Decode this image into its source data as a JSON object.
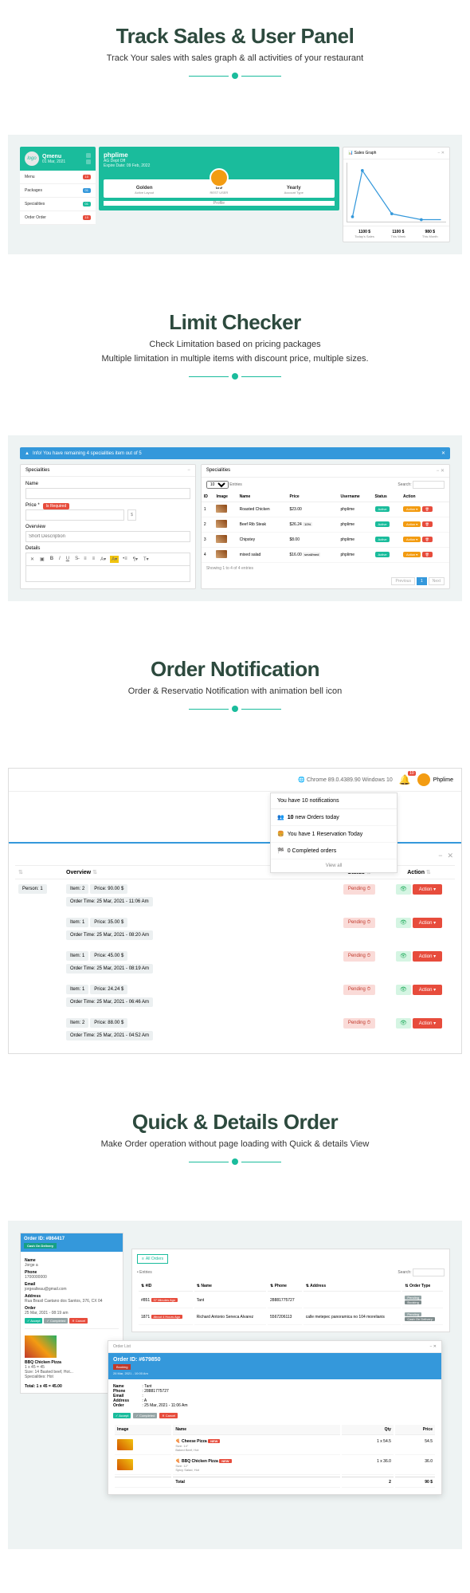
{
  "section1": {
    "title": "Track Sales & User Panel",
    "subtitle": "Track Your sales with sales graph & all activities of your restaurant",
    "sidebar": {
      "name": "Qmenu",
      "date": "01 Mar, 2021",
      "links": [
        {
          "label": "Menu",
          "badge": "10",
          "badgeClass": "bg-red"
        },
        {
          "label": "Packages",
          "badge": "01",
          "badgeClass": "bg-blue"
        },
        {
          "label": "Specialities",
          "badge": "01",
          "badgeClass": "bg-green"
        },
        {
          "label": "Order Order",
          "badge": "10",
          "badgeClass": "bg-red"
        }
      ]
    },
    "center": {
      "name": "phplime",
      "sub": "AG Dept Off",
      "date": "Expire Date: 09 Feb, 2022",
      "stats": [
        {
          "val": "Golden",
          "lbl": "Active Layout"
        },
        {
          "val": "0/9",
          "lbl": "REST USER"
        },
        {
          "val": "Yearly",
          "lbl": "Account Type"
        }
      ],
      "profile": "Profile"
    },
    "graph": {
      "title": "Sales Graph",
      "ymax": "700",
      "footer": [
        {
          "val": "1100 $",
          "lbl": "Today's Sales"
        },
        {
          "val": "1100 $",
          "lbl": "This Week"
        },
        {
          "val": "980 $",
          "lbl": "This Month"
        }
      ]
    }
  },
  "section2": {
    "title": "Limit Checker",
    "subtitle1": "Check Limitation based on pricing packages",
    "subtitle2": "Multiple limitation in multiple items with discount price, multiple sizes.",
    "infobar": "Info! You have remaining 4 specialities item out of 5",
    "form": {
      "title": "Specialities",
      "name": "Name",
      "price": "Price *",
      "required": "Is Required",
      "overview": "Overview",
      "details": "Details"
    },
    "table": {
      "title": "Specialities",
      "entries": "10",
      "entriesLabel": "Entries",
      "search": "Search:",
      "cols": [
        "ID",
        "Image",
        "Name",
        "Price",
        "Username",
        "Status",
        "Action"
      ],
      "rows": [
        {
          "id": "1",
          "name": "Roasted Chicken",
          "price": "$23.00",
          "user": "phplime"
        },
        {
          "id": "2",
          "name": "Beef Rib Steak",
          "price": "$26.24",
          "extra": "10%",
          "user": "phplime"
        },
        {
          "id": "3",
          "name": "Chipstey",
          "price": "$8.00",
          "user": "phplime"
        },
        {
          "id": "4",
          "name": "mixed salad",
          "price": "$16.00",
          "extra": "small/med",
          "user": "phplime"
        }
      ],
      "showing": "Showing 1 to 4 of 4 entries",
      "active": "Active",
      "action": "Action",
      "prev": "Previous",
      "page": "1",
      "next": "Next"
    }
  },
  "section3": {
    "title": "Order Notification",
    "subtitle": "Order & Reservatio Notification with animation bell icon",
    "browser": "Chrome 89.0.4389.90  Windows 10",
    "bellCount": "10",
    "user": "Phplime",
    "dropdown": {
      "head": "You have 10 notifications",
      "items": [
        {
          "icon": "👥",
          "text": "10 new Orders today",
          "bold": "10"
        },
        {
          "icon": "🍔",
          "text": "You have 1 Reservation Today"
        },
        {
          "icon": "🏁",
          "text": "0 Completed orders"
        }
      ],
      "footer": "View all"
    },
    "table": {
      "cols": [
        "",
        "Overview",
        "Status",
        "Action"
      ],
      "rows": [
        {
          "person": "Person: 1",
          "items": "Item: 2",
          "price": "Price: 90.00 $",
          "time": "Order Time: 25 Mar, 2021 - 11:06 Am"
        },
        {
          "items": "Item: 1",
          "price": "Price: 35.00 $",
          "time": "Order Time: 25 Mar, 2021 - 08:20 Am"
        },
        {
          "items": "Item: 1",
          "price": "Price: 45.00 $",
          "time": "Order Time: 25 Mar, 2021 - 08:19 Am"
        },
        {
          "items": "Item: 1",
          "price": "Price: 24.24 $",
          "time": "Order Time: 25 Mar, 2021 - 06:46 Am"
        },
        {
          "items": "Item: 2",
          "price": "Price: 88.00 $",
          "time": "Order Time: 25 Mar, 2021 - 04:52 Am"
        }
      ],
      "pending": "Pending",
      "action": "Action"
    }
  },
  "section4": {
    "title": "Quick & Details Order",
    "subtitle": "Make Order operation without page loading  with Quick & details View",
    "orderCard": {
      "id": "Order ID: #864417",
      "cod": "Cash On Delivery",
      "name": "Name",
      "nameVal": "Jorge a",
      "phone": "Phone",
      "phoneVal": "1700000000",
      "email": "Email",
      "emailVal": "jorgealteau@gmail.com",
      "address": "Address",
      "addressVal": "Rua Brasil Caetano dos Santos, 376, CX 04",
      "order": "Order",
      "orderVal": "25 Mar, 2021 - 08:19 am",
      "accept": "Accept",
      "completed": "Completed",
      "cancel": "Cancel",
      "item": "BBQ Chicken Pizza",
      "itemPrice": "1 x 45 = 45",
      "itemInfo": "Size: 14   Basted beef, Hot...",
      "specialNote": "Specialities: Hot",
      "total": "Total: 1 x 45 = 45.00"
    },
    "bigPanel": {
      "allOrders": "All Orders",
      "entries": "Entries",
      "search": "Search:",
      "cols": [
        "#ID",
        "Name",
        "Phone",
        "Address",
        "Order Type"
      ],
      "rows": [
        {
          "id": "#851",
          "new": "37 Minutes Ago",
          "name": "Tant",
          "phone": "28881775727",
          "addr": "",
          "type": "Booking"
        },
        {
          "id": "1871",
          "new": "About 4 Hours Ago",
          "name": "Richard Antonio Seneca Alvarez",
          "phone": "5567206113",
          "addr": "calle metepec panoramica no 104 morelianis",
          "type": "Cash On Delivery"
        }
      ],
      "pending": "Pending"
    },
    "modal": {
      "listTitle": "Order List",
      "orderId": "Order ID: #679850",
      "booking": "Booking",
      "date": "26 Mar, 2021 - 10:00 Am",
      "name": "Name",
      "nameVal": "Tant",
      "phone": "Phone",
      "phoneVal": "28881775727",
      "email": "Email",
      "emailVal": "",
      "address": "Address",
      "addressVal": "A",
      "order": "Order",
      "orderVal": "25 Mar, 2021 - 11:06 Am",
      "accept": "Accept",
      "completed": "Completed",
      "cancel": "Cancel",
      "tableCols": [
        "Image",
        "Name",
        "Qty",
        "Price"
      ],
      "items": [
        {
          "name": "Cheese Pizza",
          "size": "Size: 14\"",
          "extra": "Baked Beef, Hot",
          "qty": "1 x 54.5",
          "price": "54.5"
        },
        {
          "name": "BBQ Chicken Pizza",
          "size": "Size: 12\"",
          "extra": "Spicy Salad, Hot",
          "qty": "1 x 36.0",
          "price": "36.0"
        }
      ],
      "total": "Total",
      "totalQty": "2",
      "totalPrice": "90 $"
    }
  }
}
